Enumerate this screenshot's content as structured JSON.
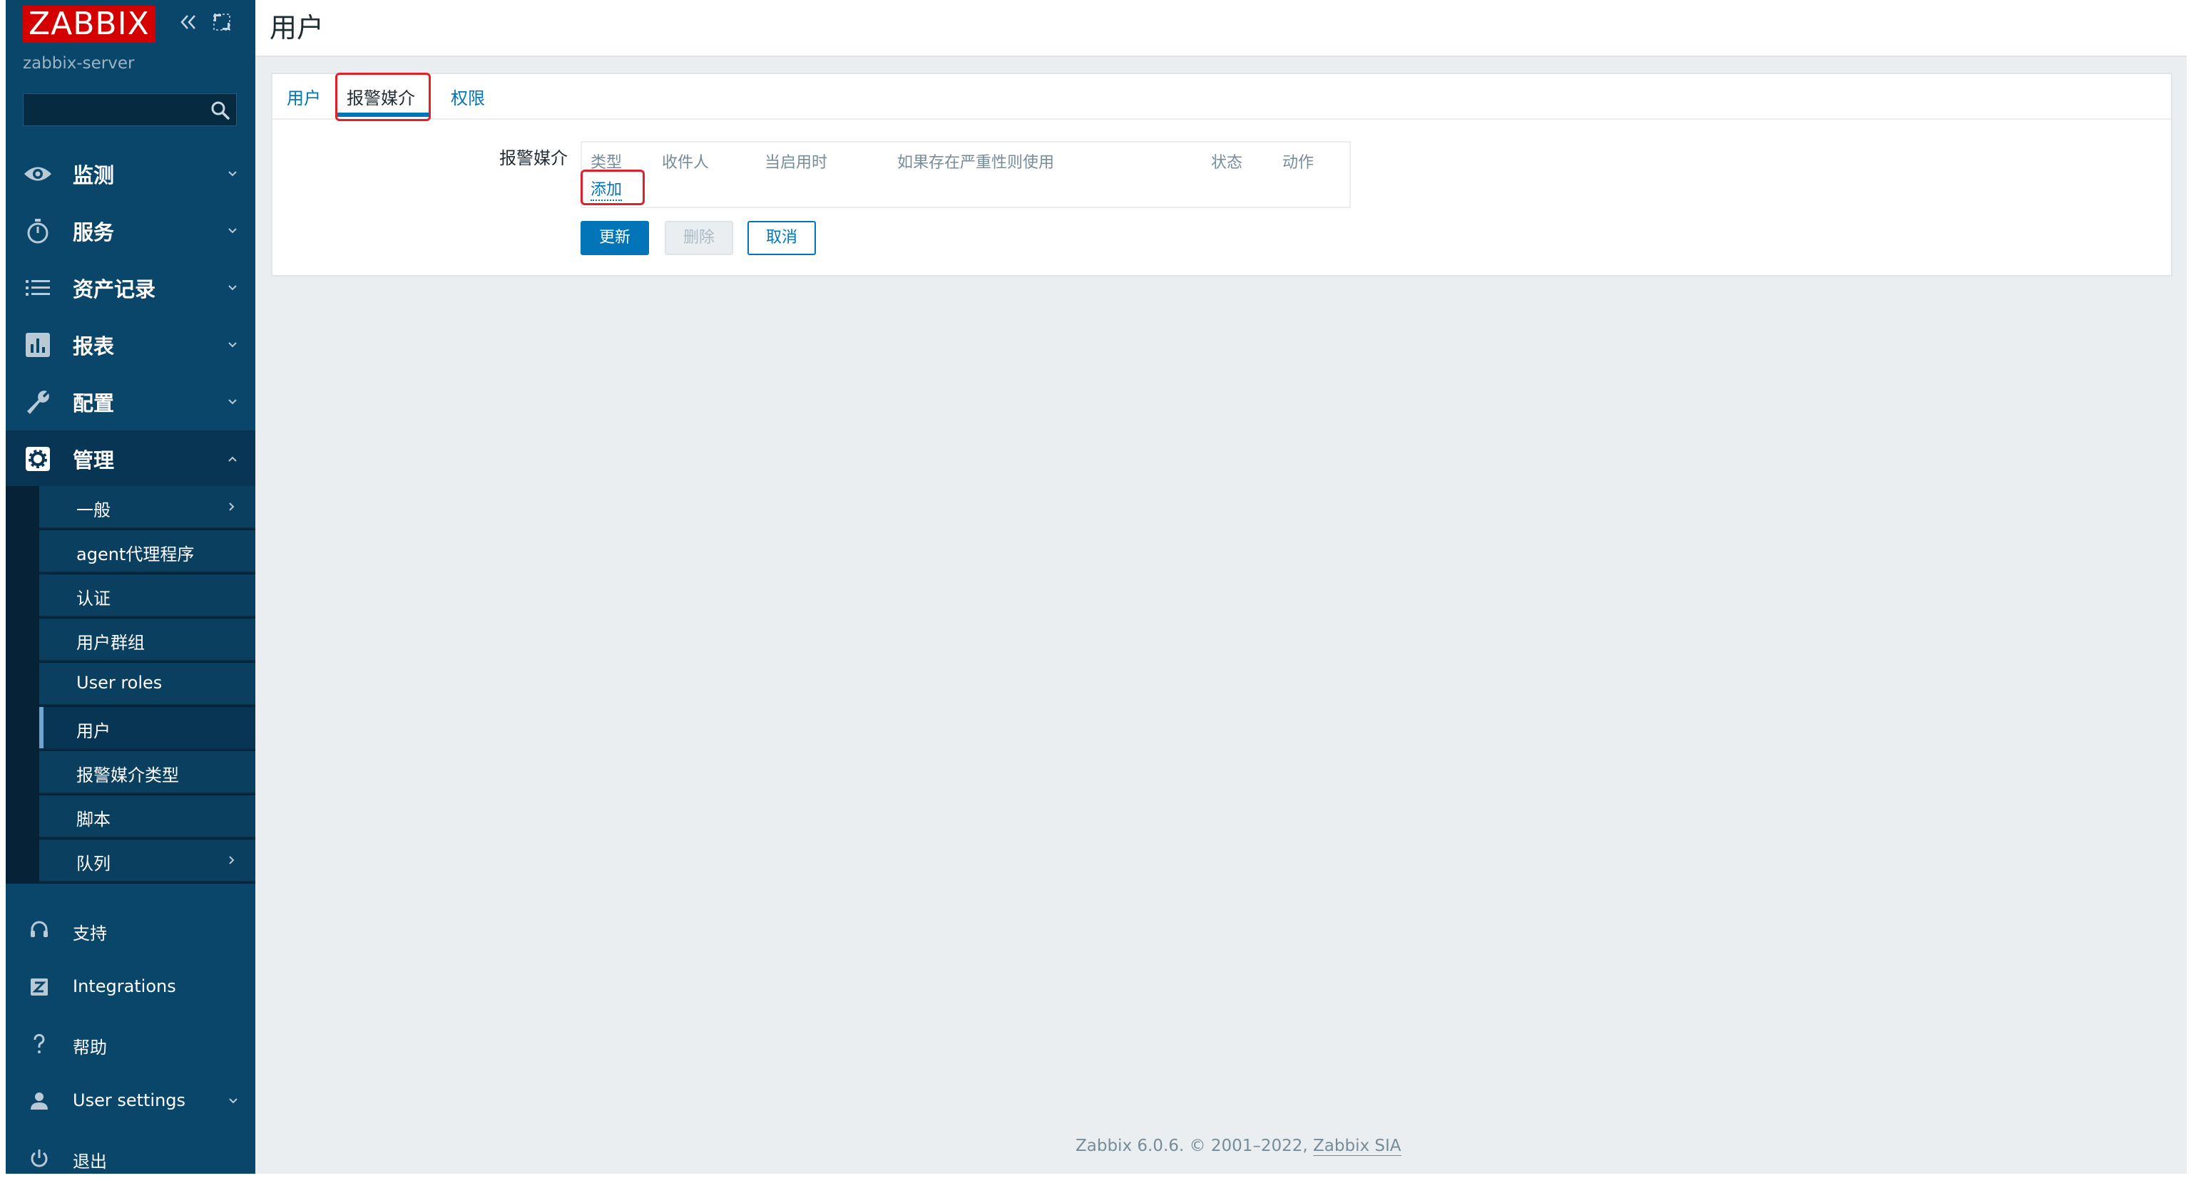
{
  "sidebar": {
    "logo": "ZABBIX",
    "server_name": "zabbix-server",
    "search": {
      "placeholder": ""
    },
    "menu": [
      {
        "label": "监测",
        "icon": "eye-icon"
      },
      {
        "label": "服务",
        "icon": "stopwatch-icon"
      },
      {
        "label": "资产记录",
        "icon": "list-icon"
      },
      {
        "label": "报表",
        "icon": "bar-chart-icon"
      },
      {
        "label": "配置",
        "icon": "wrench-icon"
      },
      {
        "label": "管理",
        "icon": "gear-icon"
      }
    ],
    "admin_submenu": [
      {
        "label": "一般"
      },
      {
        "label": "agent代理程序"
      },
      {
        "label": "认证"
      },
      {
        "label": "用户群组"
      },
      {
        "label": "User roles"
      },
      {
        "label": "用户"
      },
      {
        "label": "报警媒介类型"
      },
      {
        "label": "脚本"
      },
      {
        "label": "队列"
      }
    ],
    "bottom": [
      {
        "label": "支持",
        "icon": "headset-icon"
      },
      {
        "label": "Integrations",
        "icon": "integrations-icon"
      },
      {
        "label": "帮助",
        "icon": "help-icon"
      },
      {
        "label": "User settings",
        "icon": "user-icon"
      },
      {
        "label": "退出",
        "icon": "power-icon"
      }
    ]
  },
  "header": {
    "title": "用户"
  },
  "tabs": [
    {
      "label": "用户"
    },
    {
      "label": "报警媒介"
    },
    {
      "label": "权限"
    }
  ],
  "form": {
    "media_label": "报警媒介",
    "table_headers": [
      "类型",
      "收件人",
      "当启用时",
      "如果存在严重性则使用",
      "状态",
      "动作"
    ],
    "add_link": "添加",
    "buttons": {
      "update": "更新",
      "delete": "删除",
      "cancel": "取消"
    }
  },
  "footer": {
    "text": "Zabbix 6.0.6. © 2001–2022, ",
    "link": "Zabbix SIA"
  },
  "colors": {
    "sidebar": "#0a466a",
    "logo": "#d40000",
    "link": "#0275b8",
    "highlight": "#e0202a"
  }
}
